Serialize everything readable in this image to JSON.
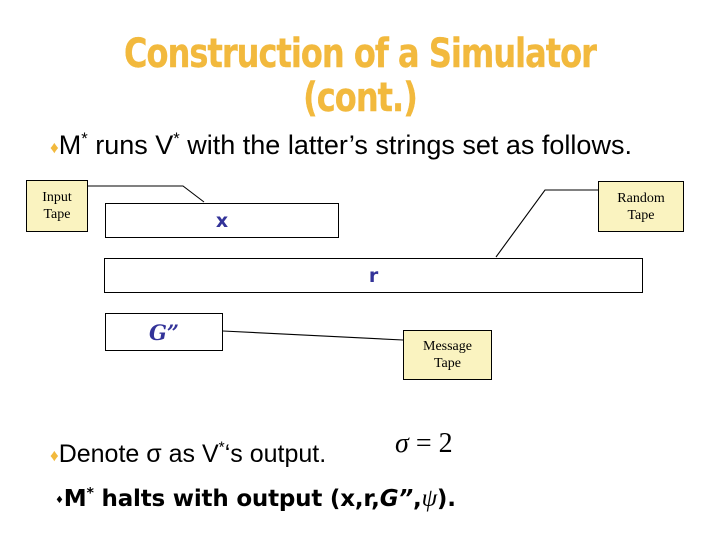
{
  "slide": {
    "title_line1": "Construction of a Simulator",
    "title_line2": "(cont.)",
    "title_color": "#F2B93D",
    "background_color": "#FFFFFF"
  },
  "bullets": {
    "bullet_glyph": "♦",
    "sub_bullet_glyph": "♦",
    "runs": {
      "marker": "♦",
      "text_a": "M",
      "star_a": "*",
      "text_b": " runs V",
      "star_b": "*",
      "text_c": " with the latter’s strings set as follows."
    },
    "denote": {
      "marker": "♦",
      "text_a": "Denote σ as V",
      "star": "*",
      "text_b": "‘s output."
    },
    "halts": {
      "marker": "♦",
      "text_a": "M",
      "star": "*",
      "text_b": " halts with output (x,r,",
      "g_label": "G”",
      "text_c": ",",
      "psi": "ψ",
      "text_d": ")."
    }
  },
  "equation": {
    "sigma": "σ",
    "operator": " = ",
    "value": "2"
  },
  "tapes": [
    {
      "name": "input-tape-strip",
      "content": "x",
      "color": "#333399"
    },
    {
      "name": "random-tape-strip",
      "content": "r",
      "color": "#333399"
    },
    {
      "name": "message-tape-strip",
      "content": "G”",
      "color": "#333399"
    }
  ],
  "callouts": [
    {
      "name": "input-tape-label",
      "line1": "Input",
      "line2": "Tape",
      "fill": "#FAF3C0"
    },
    {
      "name": "random-tape-label",
      "line1": "Random",
      "line2": "Tape",
      "fill": "#FAF3C0"
    },
    {
      "name": "message-tape-label",
      "line1": "Message",
      "line2": "Tape",
      "fill": "#FAF3C0"
    }
  ]
}
